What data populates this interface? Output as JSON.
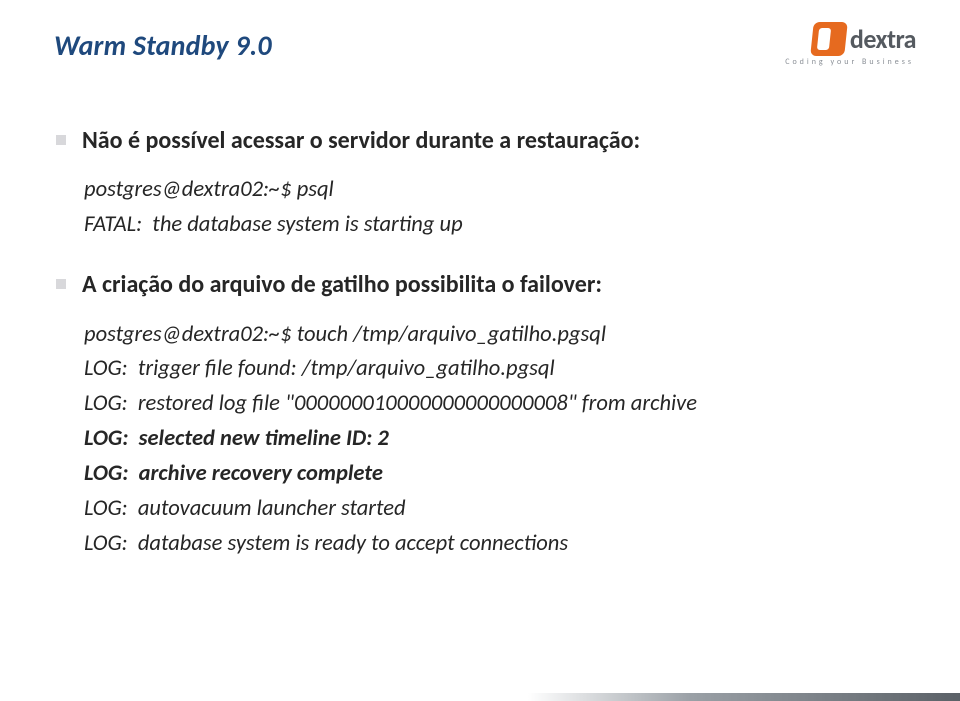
{
  "title": "Warm Standby 9.0",
  "logo": {
    "brand": "dextra",
    "tagline": "Coding your Business"
  },
  "blocks": [
    {
      "bullet": "Não é possível acessar o servidor durante a restauração:",
      "lines": [
        {
          "text": "postgres@dextra02:~$ psql",
          "bold": false
        },
        {
          "text": "FATAL:  the database system is starting up",
          "bold": false
        }
      ]
    },
    {
      "bullet": "A criação do arquivo de gatilho possibilita o failover:",
      "lines": [
        {
          "text": "postgres@dextra02:~$ touch /tmp/arquivo_gatilho.pgsql",
          "bold": false
        },
        {
          "text": "LOG:  trigger file found: /tmp/arquivo_gatilho.pgsql",
          "bold": false
        },
        {
          "text": "LOG:  restored log file \"000000010000000000000008\" from archive",
          "bold": false
        },
        {
          "text": "LOG:  selected new timeline ID: 2",
          "bold": true
        },
        {
          "text": "LOG:  archive recovery complete",
          "bold": true
        },
        {
          "text": "LOG:  autovacuum launcher started",
          "bold": false
        },
        {
          "text": "LOG:  database system is ready to accept connections",
          "bold": false
        }
      ]
    }
  ]
}
